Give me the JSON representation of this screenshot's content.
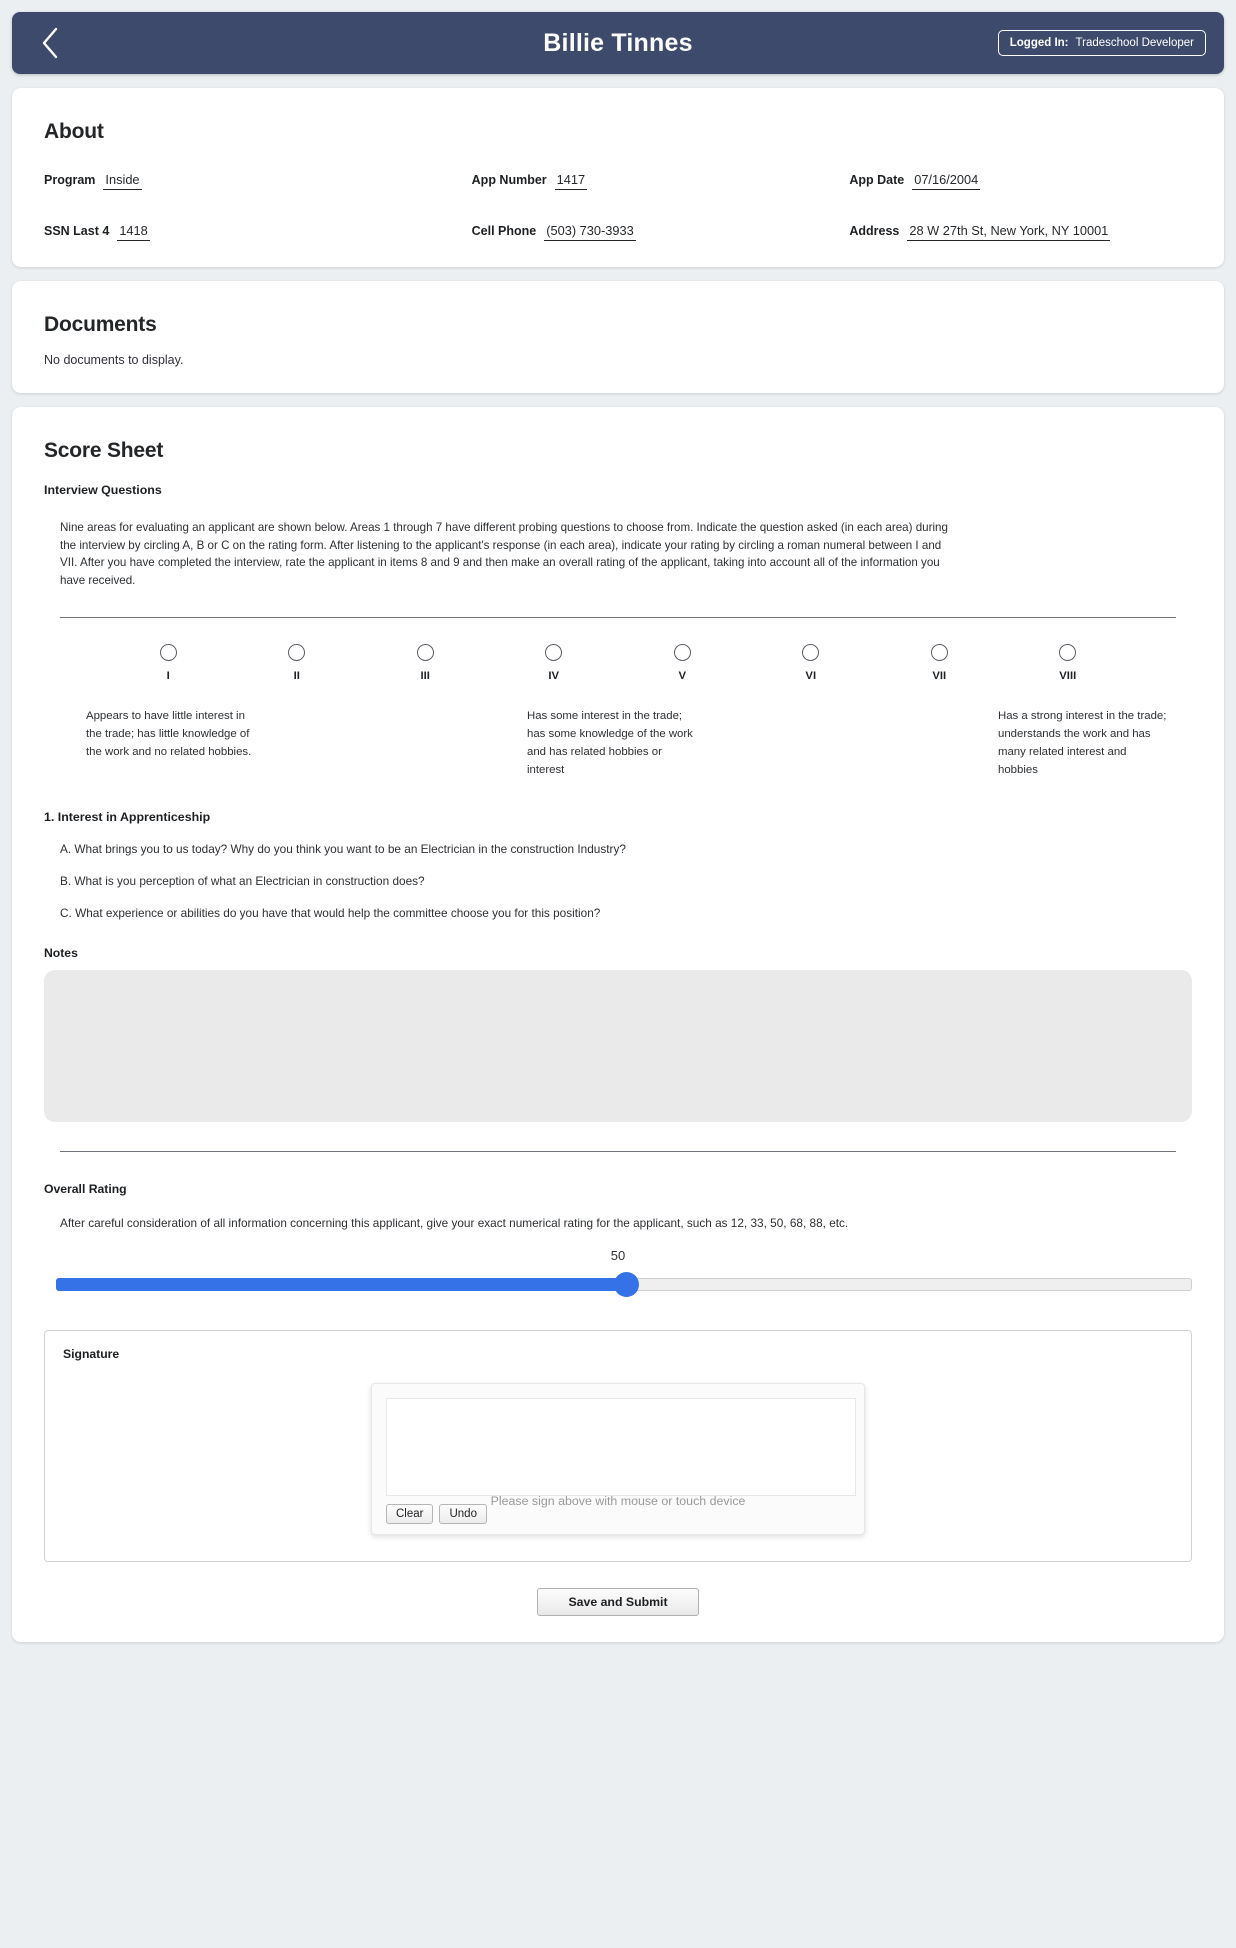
{
  "header": {
    "back_icon": "chevron-left-icon",
    "title": "Billie Tinnes",
    "logged_in_label": "Logged In:",
    "logged_in_user": "Tradeschool Developer",
    "bar_color": "#3d4a6b"
  },
  "about": {
    "heading": "About",
    "fields": [
      {
        "label": "Program",
        "value": "Inside"
      },
      {
        "label": "App Number",
        "value": "1417"
      },
      {
        "label": "App Date",
        "value": "07/16/2004"
      },
      {
        "label": "SSN Last 4",
        "value": "1418"
      },
      {
        "label": "Cell Phone",
        "value": "(503) 730-3933"
      },
      {
        "label": "Address",
        "value": "28 W 27th St, New York, NY 10001"
      }
    ]
  },
  "documents": {
    "heading": "Documents",
    "empty_text": "No documents to display."
  },
  "score_sheet": {
    "heading": "Score Sheet",
    "interview_questions_label": "Interview Questions",
    "intro": "Nine areas for evaluating an applicant are shown below. Areas 1 through 7 have different probing questions to choose from. Indicate the question asked (in each area) during the interview by circling A, B or C on the rating form. After listening to the applicant's response (in each area), indicate your rating by circling a roman numeral between I and VII. After you have completed the interview, rate the applicant in items 8 and 9 and then make an overall rating of the applicant, taking into account all of the information you have received.",
    "scale": [
      {
        "label": "I",
        "selected": false
      },
      {
        "label": "II",
        "selected": false
      },
      {
        "label": "III",
        "selected": false
      },
      {
        "label": "IV",
        "selected": false
      },
      {
        "label": "V",
        "selected": false
      },
      {
        "label": "VI",
        "selected": false
      },
      {
        "label": "VII",
        "selected": false
      },
      {
        "label": "VIII",
        "selected": false
      }
    ],
    "descriptors": [
      "Appears to have little interest in the trade; has little knowledge of the work and no related hobbies.",
      "Has some interest in the trade; has some knowledge of the work and has related hobbies or interest",
      "Has a strong interest in the trade; understands the work and has many related interest and hobbies"
    ],
    "question_group": {
      "title": "1. Interest in Apprenticeship",
      "options": [
        "A. What brings you to us today? Why do you think you want to be an Electrician in the construction Industry?",
        "B. What is you perception of what an Electrician in construction does?",
        "C. What experience or abilities do you have that would help the committee choose you for this position?"
      ]
    },
    "notes": {
      "label": "Notes",
      "value": "",
      "placeholder": ""
    },
    "overall": {
      "label": "Overall Rating",
      "description": "After careful consideration of all information concerning this applicant, give your exact numerical rating for the applicant, such as 12, 33, 50, 68, 88, etc.",
      "value": "50",
      "min": 0,
      "max": 100,
      "fill_color": "#3572e8"
    },
    "signature": {
      "title": "Signature",
      "hint": "Please sign above with mouse or touch device",
      "clear_label": "Clear",
      "undo_label": "Undo"
    },
    "submit_label": "Save and Submit"
  }
}
